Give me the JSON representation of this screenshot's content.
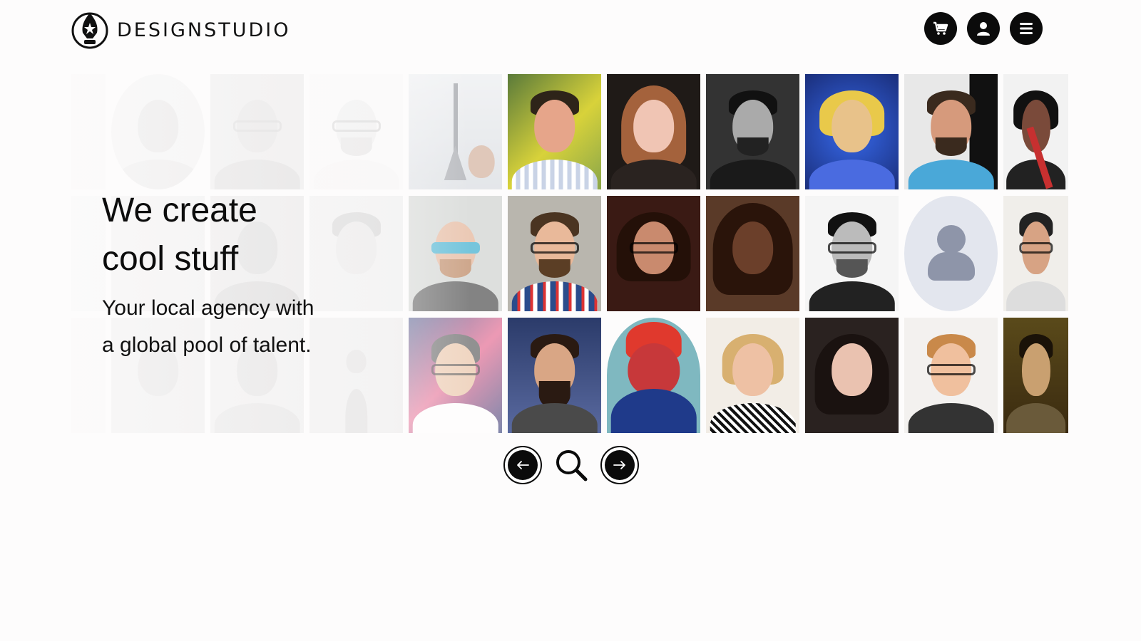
{
  "brand": {
    "name": "DESIGNSTUDIO",
    "logo_icon": "pen-nib-logo-icon"
  },
  "header": {
    "actions": [
      {
        "name": "cart-button",
        "icon": "cart-icon"
      },
      {
        "name": "account-button",
        "icon": "user-icon"
      },
      {
        "name": "menu-button",
        "icon": "hamburger-menu-icon"
      }
    ]
  },
  "hero": {
    "title_line1": "We create",
    "title_line2": "cool stuff",
    "subtitle_line1": "Your local agency with",
    "subtitle_line2": "a global pool of talent."
  },
  "carousel": {
    "prev_icon": "arrow-left-icon",
    "search_icon": "search-icon",
    "next_icon": "arrow-right-icon"
  },
  "colors": {
    "background": "#fdfcfc",
    "button_fill": "#0b0b0b",
    "placeholder_avatar_bg": "#e3e6ee",
    "placeholder_avatar_fg": "#8e95a9"
  }
}
